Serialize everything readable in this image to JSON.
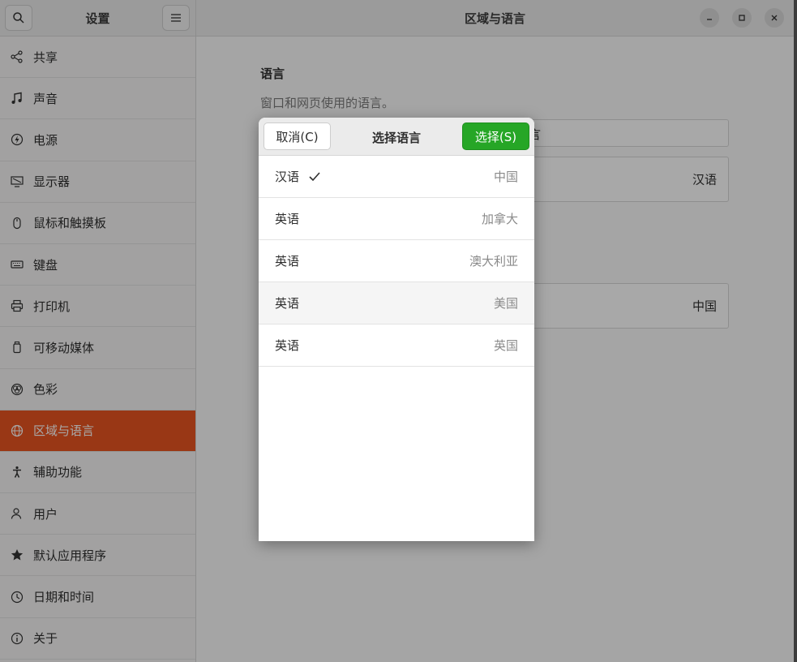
{
  "sidebar": {
    "title": "设置",
    "items": [
      {
        "label": "共享",
        "icon": "share-icon"
      },
      {
        "label": "声音",
        "icon": "music-note-icon"
      },
      {
        "label": "电源",
        "icon": "power-icon"
      },
      {
        "label": "显示器",
        "icon": "display-icon"
      },
      {
        "label": "鼠标和触摸板",
        "icon": "mouse-icon"
      },
      {
        "label": "键盘",
        "icon": "keyboard-icon"
      },
      {
        "label": "打印机",
        "icon": "printer-icon"
      },
      {
        "label": "可移动媒体",
        "icon": "usb-drive-icon"
      },
      {
        "label": "色彩",
        "icon": "color-icon"
      },
      {
        "label": "区域与语言",
        "icon": "globe-icon",
        "active": true
      },
      {
        "label": "辅助功能",
        "icon": "accessibility-icon"
      },
      {
        "label": "用户",
        "icon": "users-icon"
      },
      {
        "label": "默认应用程序",
        "icon": "star-icon"
      },
      {
        "label": "日期和时间",
        "icon": "clock-icon"
      },
      {
        "label": "关于",
        "icon": "info-icon"
      }
    ]
  },
  "main": {
    "title": "区域与语言",
    "language_section": {
      "title": "语言",
      "description": "窗口和网页使用的语言。",
      "field_partial_text": "言",
      "value": "汉语"
    },
    "format_row": {
      "value": "中国"
    }
  },
  "dialog": {
    "title": "选择语言",
    "cancel_label": "取消(C)",
    "select_label": "选择(S)",
    "languages": [
      {
        "name": "汉语",
        "region": "中国",
        "selected": true
      },
      {
        "name": "英语",
        "region": "加拿大"
      },
      {
        "name": "英语",
        "region": "澳大利亚"
      },
      {
        "name": "英语",
        "region": "美国",
        "highlighted": true
      },
      {
        "name": "英语",
        "region": "英国"
      }
    ]
  },
  "colors": {
    "accent": "#e95420",
    "select_button": "#26a626"
  }
}
